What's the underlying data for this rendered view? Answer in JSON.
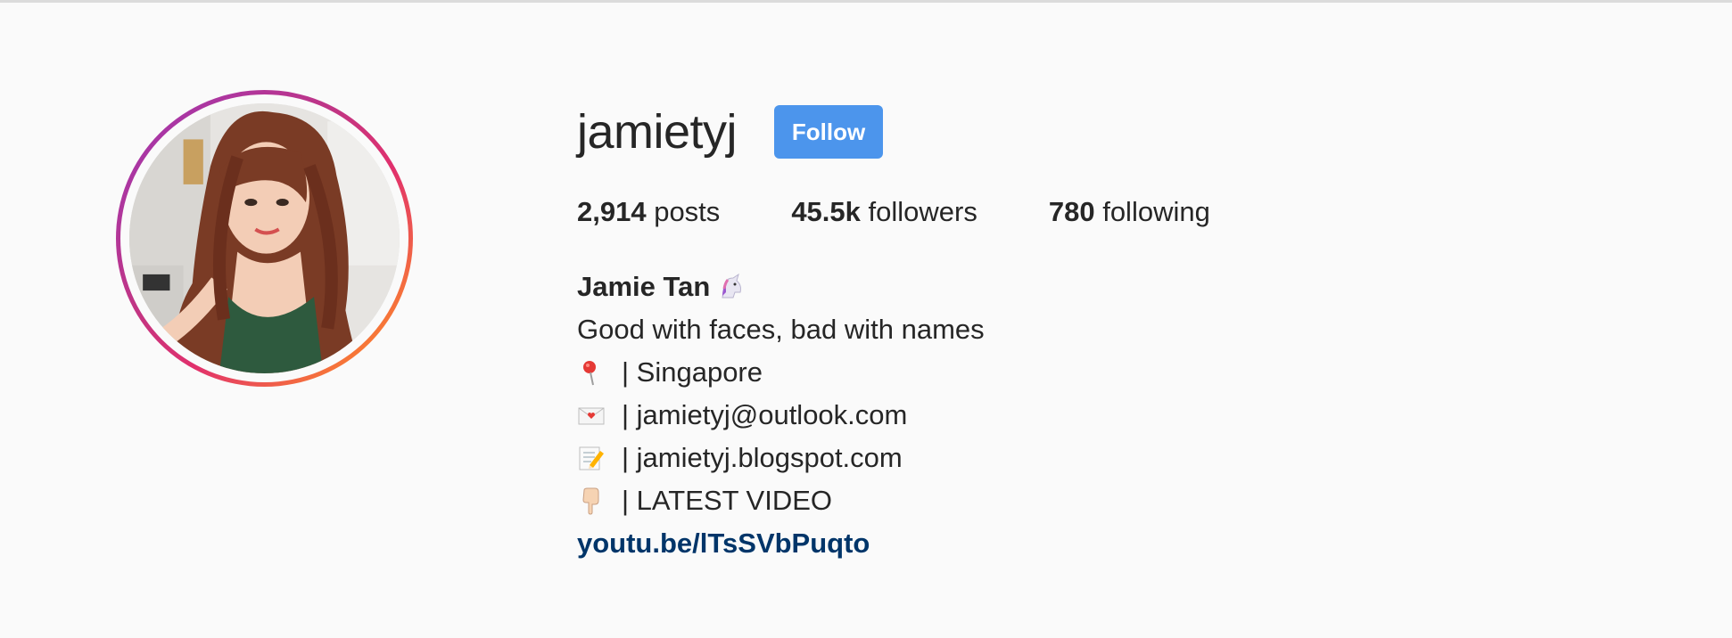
{
  "profile": {
    "username": "jamietyj",
    "follow_label": "Follow",
    "stats": {
      "posts_count": "2,914",
      "posts_label": "posts",
      "followers_count": "45.5k",
      "followers_label": "followers",
      "following_count": "780",
      "following_label": "following"
    },
    "bio": {
      "full_name": "Jamie Tan",
      "name_emoji": "unicorn-icon",
      "lines": [
        {
          "icon": "pin-icon",
          "text": "| Singapore"
        },
        {
          "icon": "love-letter-icon",
          "text": "| jamietyj@outlook.com"
        },
        {
          "icon": "memo-icon",
          "text": "| jamietyj.blogspot.com"
        },
        {
          "icon": "pointing-down-icon",
          "text": "| LATEST VIDEO"
        }
      ],
      "tagline": "Good with faces, bad with names",
      "link": "youtu.be/lTsSVbPuqto"
    }
  },
  "colors": {
    "follow_button": "#4c95ec",
    "link": "#003569",
    "background": "#fafafa",
    "text": "#262626"
  }
}
